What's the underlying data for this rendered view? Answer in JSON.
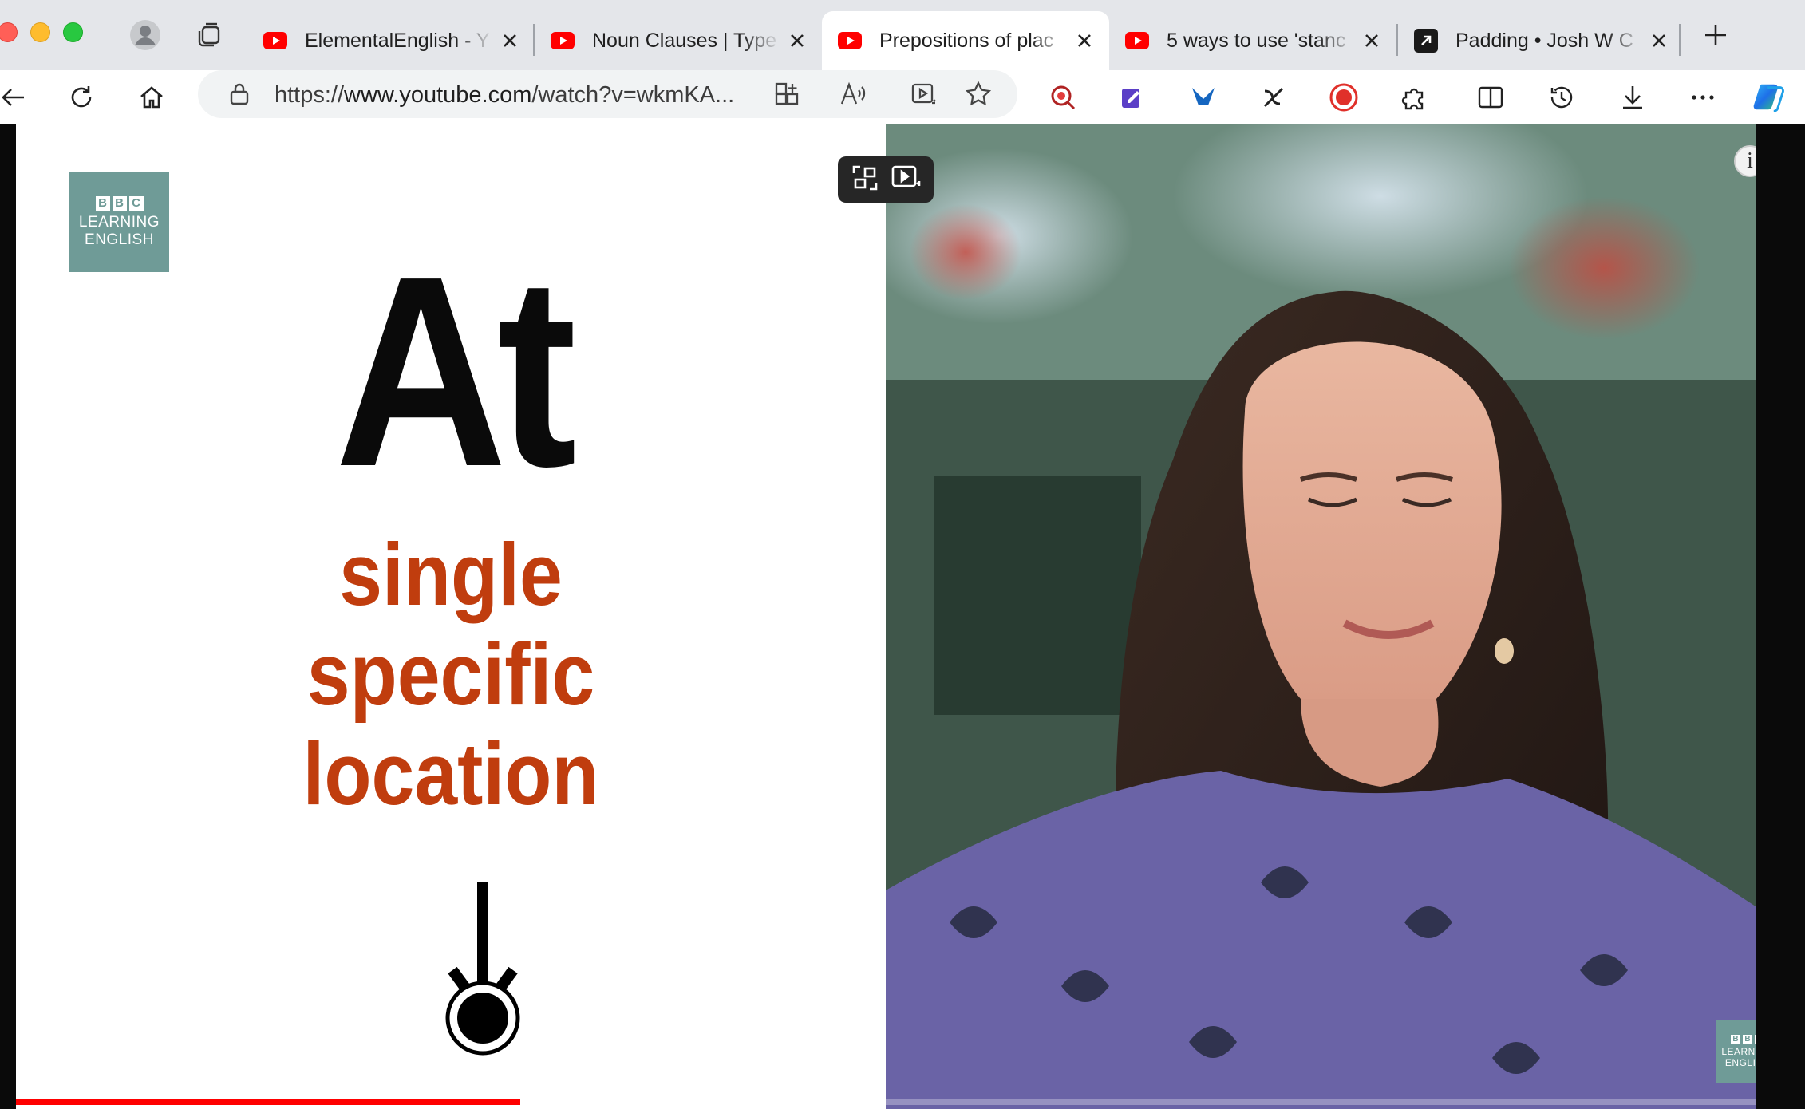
{
  "browser": {
    "tabs": [
      {
        "title": "ElementalEnglish - Y",
        "favicon": "youtube-icon",
        "active": false
      },
      {
        "title": "Noun Clauses | Type",
        "favicon": "youtube-icon",
        "active": false
      },
      {
        "title": "Prepositions of plac",
        "favicon": "youtube-icon",
        "active": true
      },
      {
        "title": "5 ways to use 'stanc",
        "favicon": "youtube-icon",
        "active": false
      },
      {
        "title": "Padding • Josh W C",
        "favicon": "external-link-icon",
        "active": false
      }
    ],
    "url_prefix": "https://",
    "url_main": "www.youtube.com",
    "url_rest": "/watch?v=wkmKA..."
  },
  "video": {
    "logo": {
      "letters": [
        "B",
        "B",
        "C"
      ],
      "line1": "LEARNING",
      "line2": "ENGLISH"
    },
    "heading": "At",
    "subtitle_lines": [
      "single",
      "specific",
      "location"
    ],
    "progress_fraction": 0.29,
    "info_label": "i"
  },
  "colors": {
    "accent_red": "#ff0000",
    "subtitle_color": "#c03d0e",
    "logo_bg": "#6f9b97"
  }
}
